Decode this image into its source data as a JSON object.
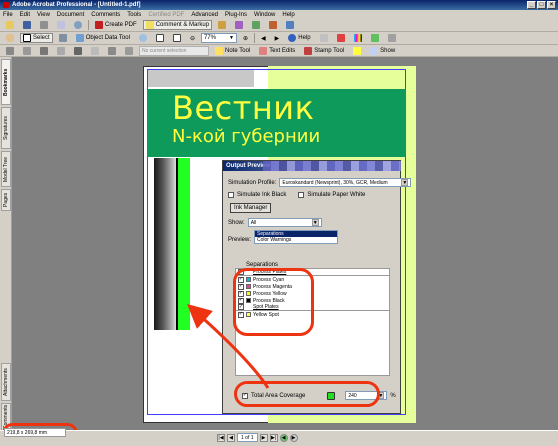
{
  "window": {
    "title": "Adobe Acrobat Professional - [Untitled-1.pdf]"
  },
  "menu": [
    "File",
    "Edit",
    "View",
    "Document",
    "Comments",
    "Tools",
    "Certified PDF",
    "Advanced",
    "Plug-Ins",
    "Window",
    "Help"
  ],
  "menu_dim_index": 6,
  "toolbar1": {
    "create_pdf": "Create PDF",
    "comment_markup": "Comment & Markup"
  },
  "toolbar2": {
    "select": "Select",
    "object_data_tool": "Object Data Tool",
    "zoom": "77%",
    "help": "Help"
  },
  "toolbar3": {
    "no_selection": "No current selection",
    "note_tool": "Note Tool",
    "text_edits": "Text Edits",
    "stamp_tool": "Stamp Tool",
    "show": "Show"
  },
  "left_tabs": {
    "bookmarks": "Bookmarks",
    "signatures": "Signatures",
    "model_tree": "Model Tree",
    "pages": "Pages",
    "attachments": "Attachments",
    "comments": "Comments"
  },
  "document": {
    "title": "Вестник",
    "subtitle": "N-кой губернии"
  },
  "dialog": {
    "title": "Output Preview",
    "simulation_profile_label": "Simulation Profile:",
    "simulation_profile_value": "Euroskandard (Newsprint), 30%, GCR, Medium",
    "simulate_ink_black": "Simulate Ink Black",
    "simulate_paper_white": "Simulate Paper White",
    "ink_manager": "Ink Manager",
    "show_label": "Show:",
    "show_value": "All",
    "preview_label": "Preview:",
    "preview_options": [
      "Separations",
      "Color Warnings"
    ],
    "separations_group_label": "Separations",
    "separations": [
      {
        "label": "Process Plates",
        "color": ""
      },
      {
        "label": "Process Cyan",
        "color": "#00c0e0"
      },
      {
        "label": "Process Magenta",
        "color": "#e040a0"
      },
      {
        "label": "Process Yellow",
        "color": "#ffff00"
      },
      {
        "label": "Process Black",
        "color": "#000000"
      },
      {
        "label": "Spot Plates",
        "color": ""
      },
      {
        "label": "Yellow Spot",
        "color": "#ffff60"
      }
    ],
    "total_area_coverage": "Total Area Coverage",
    "coverage_value": "240",
    "coverage_unit": "%",
    "coverage_color": "#22dd22"
  },
  "status": {
    "page_size": "219,8 x 269,8 mm",
    "page_indicator": "1 of 1"
  },
  "annotation_color": "#ee3311"
}
